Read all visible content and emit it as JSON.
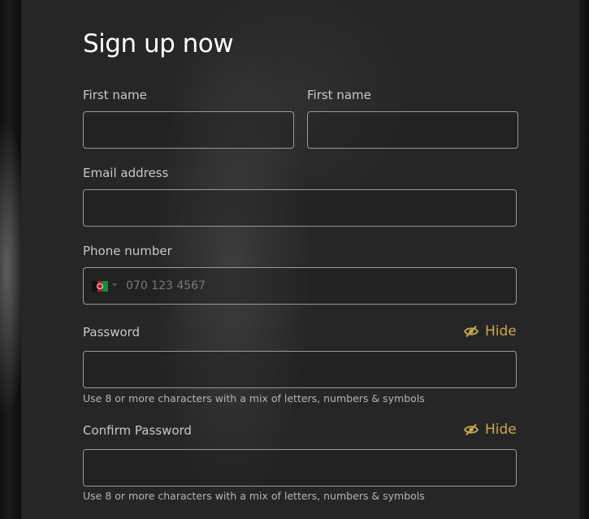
{
  "form": {
    "title": "Sign up now",
    "first_name_label": "First name",
    "second_name_label": "First name",
    "email_label": "Email address",
    "phone_label": "Phone number",
    "phone_placeholder": "070 123 4567",
    "phone_country_flag": "Afghanistan flag",
    "password_label": "Password",
    "password_toggle_label": "Hide",
    "password_hint": "Use 8 or more characters with a mix of letters, numbers & symbols",
    "confirm_password_label": "Confirm Password",
    "confirm_password_toggle_label": "Hide",
    "confirm_password_hint": "Use 8 or more characters with a mix of letters, numbers & symbols"
  },
  "colors": {
    "panel_bg": "#262626",
    "accent": "#c9a94a",
    "field_border": "#9a9a9a",
    "label_text": "#c9c9c9"
  },
  "icons": {
    "toggle": "eye-slash-icon",
    "dropdown": "caret-down-icon"
  }
}
